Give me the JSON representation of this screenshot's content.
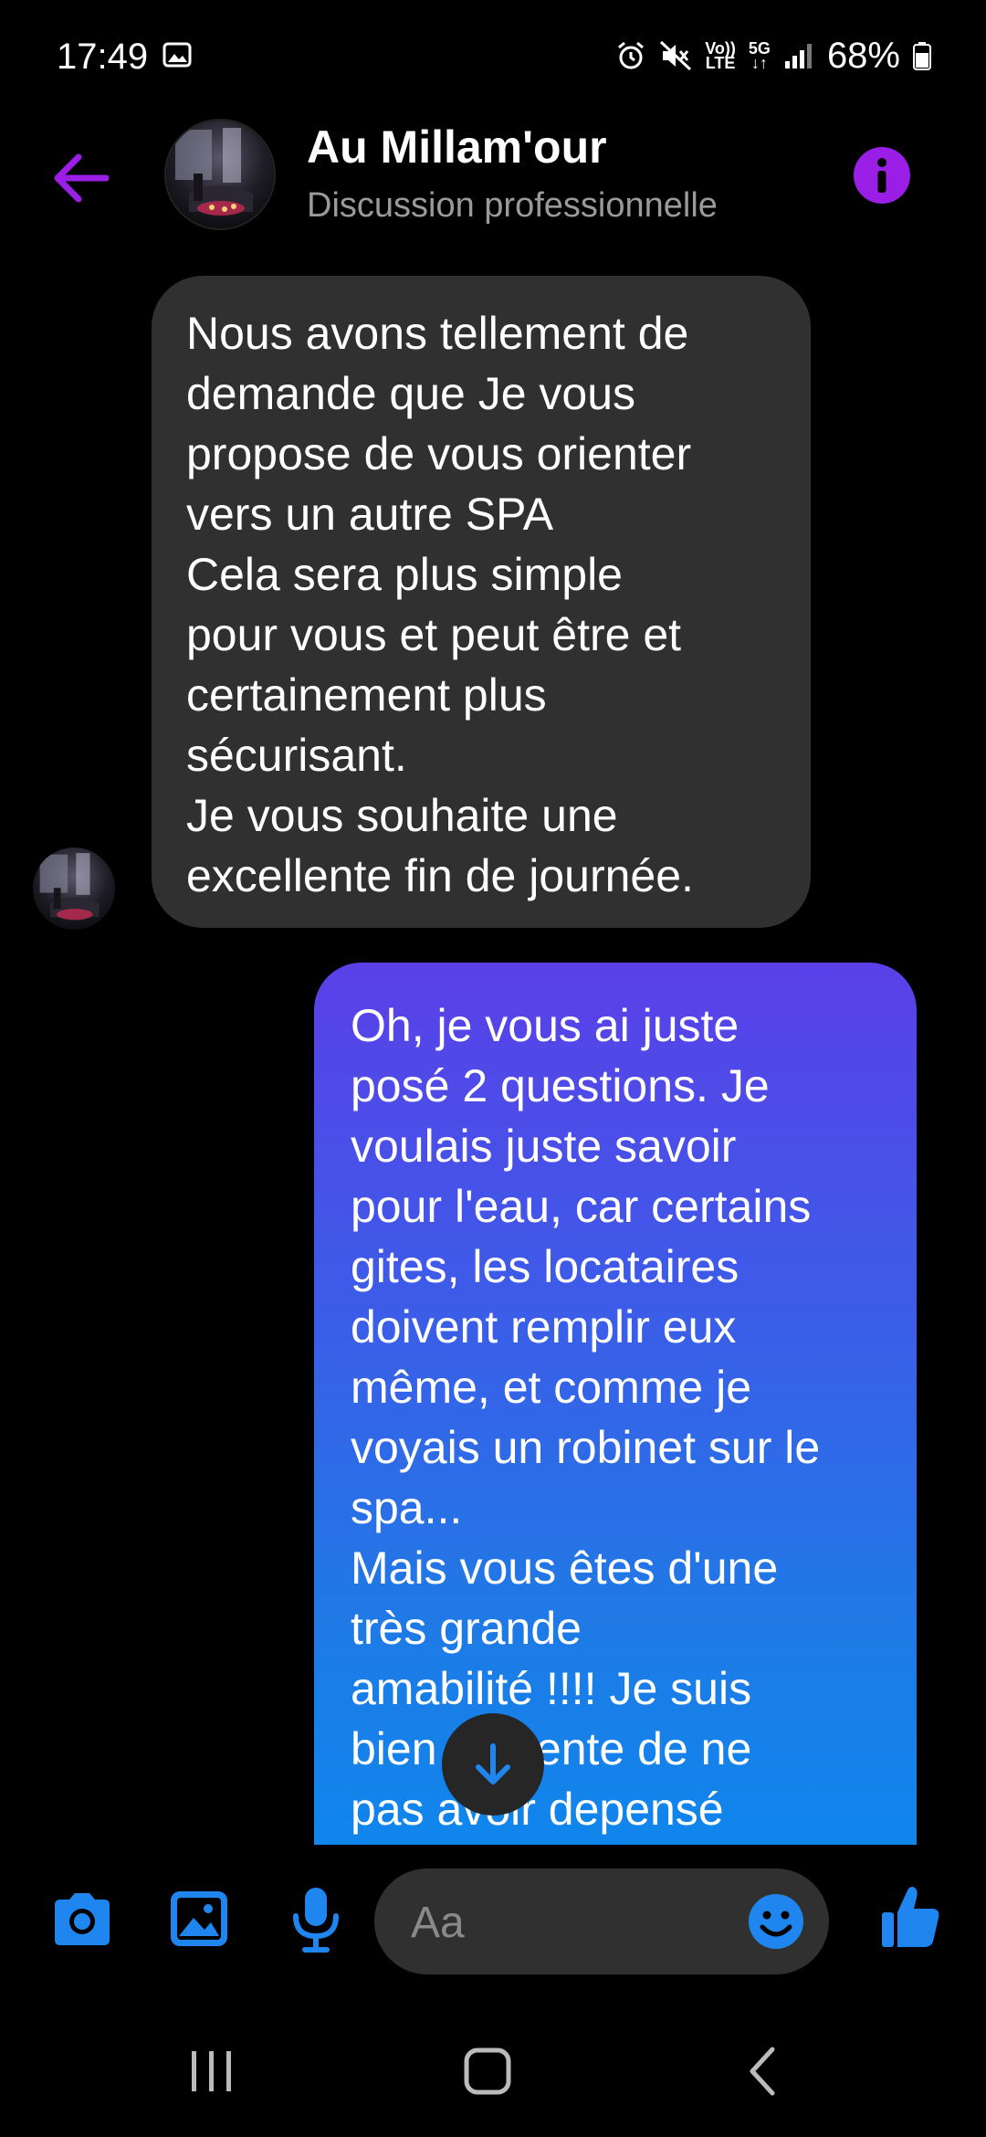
{
  "status_bar": {
    "time": "17:49",
    "volte_line1": "Vo))",
    "volte_line2": "LTE",
    "net_line1": "5G",
    "battery_percent": "68%"
  },
  "header": {
    "contact_name": "Au Millam'our",
    "contact_subtitle": "Discussion professionnelle",
    "accent_color": "#9b1ee6"
  },
  "messages": [
    {
      "direction": "incoming",
      "text": "Nous avons tellement de\ndemande que Je vous\npropose de vous orienter\nvers un autre SPA\nCela sera plus simple\npour vous et peut être et\ncertainement plus\nsécurisant.\nJe vous souhaite une\nexcellente fin de journée."
    },
    {
      "direction": "outgoing",
      "text": "Oh, je vous ai juste\nposé 2 questions. Je\nvoulais juste savoir\npour l'eau, car certains\ngites, les locataires\ndoivent remplir eux\nmême,  et comme je\nvoyais un robinet sur le\nspa...\nMais vous êtes d'une\ntrès grande\namabilité !!!! Je suis\nbien contente de ne\npas avoir depensé"
    }
  ],
  "composer": {
    "placeholder": "Aa",
    "icon_color": "#1f86f0"
  }
}
